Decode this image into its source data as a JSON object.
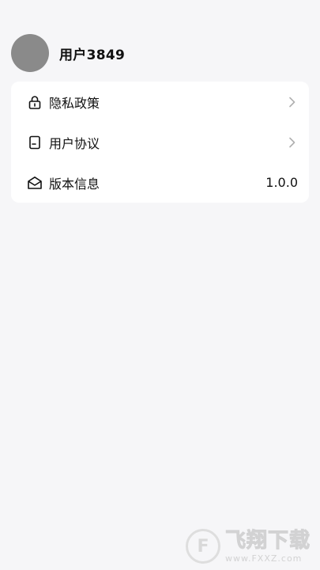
{
  "profile": {
    "username": "用户3849"
  },
  "menu": {
    "items": [
      {
        "label": "隐私政策",
        "icon": "lock-icon"
      },
      {
        "label": "用户协议",
        "icon": "document-icon"
      },
      {
        "label": "版本信息",
        "icon": "envelope-open-icon",
        "value": "1.0.0"
      }
    ]
  },
  "watermark": {
    "title": "飞翔下载",
    "url": "www.FXXZ.com",
    "logo_letter": "F"
  },
  "colors": {
    "background": "#f6f6f8",
    "card": "#ffffff",
    "avatar": "#8a8a8a",
    "chevron": "#b0b0b0"
  }
}
